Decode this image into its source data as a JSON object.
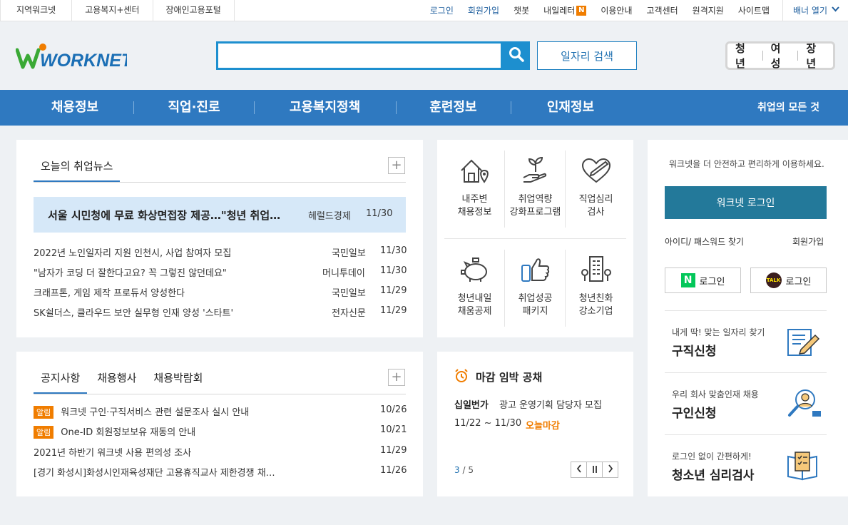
{
  "topbar": {
    "left_links": [
      "지역워크넷",
      "고용복지+센터",
      "장애인고용포털"
    ],
    "right_links": [
      {
        "label": "로그인",
        "highlight": true
      },
      {
        "label": "회원가입",
        "highlight": true
      },
      {
        "label": "챗봇",
        "highlight": false
      },
      {
        "label": "내일레터",
        "highlight": false,
        "badge": "N"
      },
      {
        "label": "이용안내",
        "highlight": false
      },
      {
        "label": "고객센터",
        "highlight": false
      },
      {
        "label": "원격지원",
        "highlight": false
      },
      {
        "label": "사이트맵",
        "highlight": false
      }
    ],
    "banner_toggle": "배너 열기"
  },
  "header": {
    "logo_text": "WORKNET",
    "search_value": "",
    "job_search_label": "일자리 검색",
    "targets": [
      "청년",
      "여성",
      "장년"
    ]
  },
  "nav": {
    "menus": [
      "채용정보",
      "직업·진로",
      "고용복지정책",
      "훈련정보",
      "인재정보"
    ],
    "all_label": "취업의 모든 것"
  },
  "news": {
    "tab": "오늘의 취업뉴스",
    "headline": {
      "title": "서울 시민청에 무료 화상면접장 제공…\"청년 취업…",
      "source": "헤럴드경제",
      "date": "11/30"
    },
    "items": [
      {
        "title": "2022년 노인일자리 지원 인천시, 사업 참여자 모집",
        "source": "국민일보",
        "date": "11/30"
      },
      {
        "title": "\"남자가 코딩 더 잘한다고요? 꼭 그렇진 않던데요\"",
        "source": "머니투데이",
        "date": "11/30"
      },
      {
        "title": "크래프톤, 게임 제작 프로듀서 양성한다",
        "source": "국민일보",
        "date": "11/29"
      },
      {
        "title": "SK쉴더스, 클라우드 보안 실무형 인재 양성 '스타트'",
        "source": "전자신문",
        "date": "11/29"
      }
    ]
  },
  "notice": {
    "tabs": [
      "공지사항",
      "채용행사",
      "채용박람회"
    ],
    "items": [
      {
        "tag": "알림",
        "title": "워크넷 구인·구직서비스 관련 설문조사 실시 안내",
        "date": "10/26"
      },
      {
        "tag": "알림",
        "title": "One-ID 회원정보보유 재동의 안내",
        "date": "10/21"
      },
      {
        "tag": "",
        "title": "2021년 하반기 워크넷 사용 편의성 조사",
        "date": "11/29"
      },
      {
        "tag": "",
        "title": "[경기 화성시]화성시인재육성재단 고용휴직교사 제한경쟁 채…",
        "date": "11/26"
      }
    ]
  },
  "services": [
    {
      "line1": "내주변",
      "line2": "채용정보",
      "icon": "house-location-icon"
    },
    {
      "line1": "취업역량",
      "line2": "강화프로그램",
      "icon": "sprout-hand-icon"
    },
    {
      "line1": "직업심리",
      "line2": "검사",
      "icon": "heart-pencil-icon"
    },
    {
      "line1": "청년내일",
      "line2": "채움공제",
      "icon": "piggy-bank-icon"
    },
    {
      "line1": "취업성공",
      "line2": "패키지",
      "icon": "thumbs-up-phone-icon"
    },
    {
      "line1": "청년친화",
      "line2": "강소기업",
      "icon": "building-icon"
    }
  ],
  "deadline": {
    "title": "마감 임박 공채",
    "company": "십일번가",
    "job": "광고 운영기획 담당자 모집",
    "period": "11/22 ~ 11/30",
    "today_label": "오늘마감",
    "page_current": "3",
    "page_sep": " / ",
    "page_total": "5"
  },
  "login_panel": {
    "guide": "워크넷을 더 안전하고 편리하게 이용하세요.",
    "login_button": "워크넷 로그인",
    "find_id": "아이디/ 패스워드 찾기",
    "join": "회원가입",
    "naver_login": "로그인",
    "naver_mark": "N",
    "kakao_login": "로그인",
    "kakao_mark": "TALK"
  },
  "quick_links": [
    {
      "sub": "내게 딱! 맞는 일자리 찾기",
      "main": "구직신청",
      "icon": "resume-pencil-icon"
    },
    {
      "sub": "우리 회사 맞춤인재 채용",
      "main": "구인신청",
      "icon": "magnifier-person-icon"
    },
    {
      "sub": "로그인 없이 간편하게!",
      "main": "청소년 심리검사",
      "icon": "book-checklist-icon"
    }
  ],
  "colors": {
    "brand_blue": "#2f79c0",
    "accent_orange": "#f07d00",
    "login_teal": "#23799a",
    "logo_green": "#3aa935"
  }
}
